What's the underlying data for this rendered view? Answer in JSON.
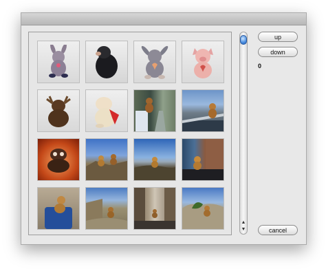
{
  "controls": {
    "up_label": "up",
    "down_label": "down",
    "index_value": "0",
    "cancel_label": "cancel"
  },
  "photos": [
    {
      "icon": "plush-donkey-photo"
    },
    {
      "icon": "plush-black-mole-photo"
    },
    {
      "icon": "plush-donkey-heart-photo"
    },
    {
      "icon": "plush-pig-photo"
    },
    {
      "icon": "plush-moose-photo"
    },
    {
      "icon": "plush-pig-scarf-photo"
    },
    {
      "icon": "teddy-on-tramway-photo"
    },
    {
      "icon": "teddy-at-harbour-photo"
    },
    {
      "icon": "plush-on-orange-photo"
    },
    {
      "icon": "teddies-on-rocks-photo"
    },
    {
      "icon": "teddy-by-sea-photo"
    },
    {
      "icon": "teddy-by-stone-wall-photo"
    },
    {
      "icon": "teddy-on-blue-bag-photo"
    },
    {
      "icon": "teddy-in-ruins-photo"
    },
    {
      "icon": "teddy-in-street-photo"
    },
    {
      "icon": "teddy-on-boulders-photo"
    }
  ],
  "colors": {
    "window_bg": "#e8e8e8",
    "scroll_knob": "#4a8ee0"
  }
}
